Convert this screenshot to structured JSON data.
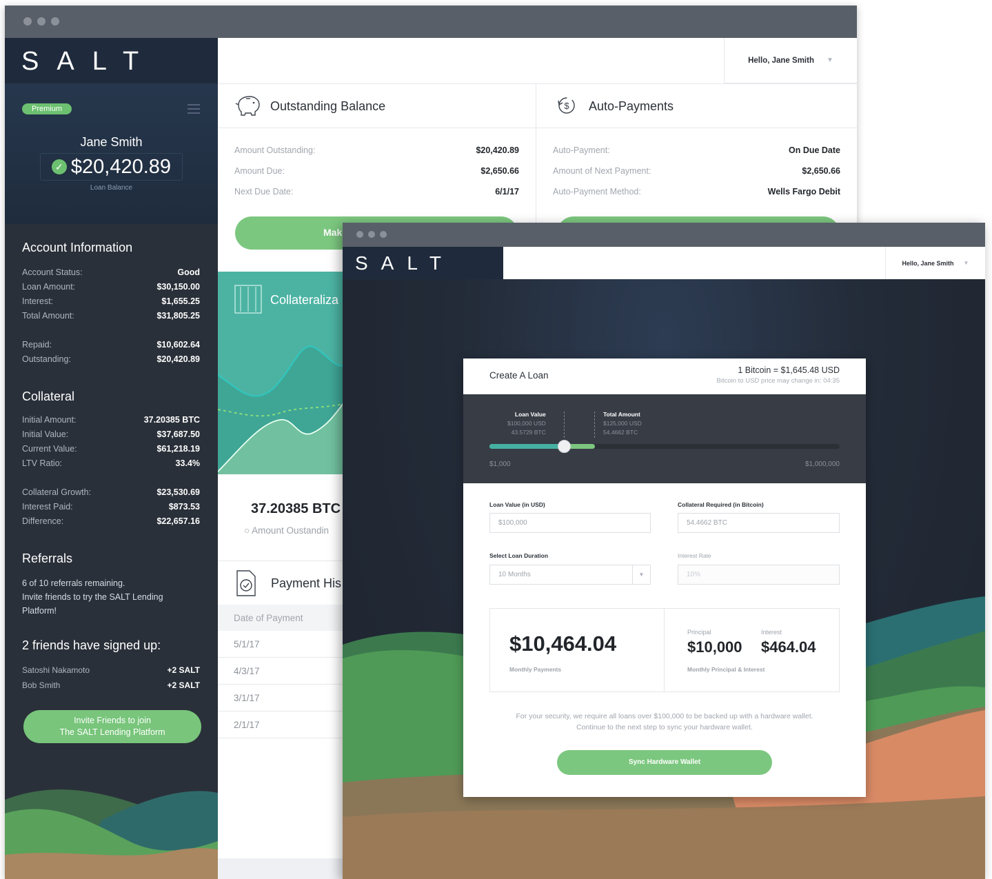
{
  "brand": {
    "logo": "SALT"
  },
  "colors": {
    "accent_green": "#7cc77f",
    "teal": "#4cb3a3",
    "sidebar_bg": "#2a3039",
    "navy": "#1f2b3c"
  },
  "sidebar": {
    "badge": "Premium",
    "user_name": "Jane Smith",
    "loan_balance": "$20,420.89",
    "loan_balance_label": "Loan Balance",
    "account_info": {
      "title": "Account Information",
      "rows": [
        {
          "k": "Account Status:",
          "v": "Good"
        },
        {
          "k": "Loan Amount:",
          "v": "$30,150.00"
        },
        {
          "k": "Interest:",
          "v": "$1,655.25"
        },
        {
          "k": "Total Amount:",
          "v": "$31,805.25"
        },
        {
          "k": "Repaid:",
          "v": "$10,602.64"
        },
        {
          "k": "Outstanding:",
          "v": "$20,420.89"
        }
      ]
    },
    "collateral": {
      "title": "Collateral",
      "rows": [
        {
          "k": "Initial Amount:",
          "v": "37.20385 BTC"
        },
        {
          "k": "Initial Value:",
          "v": "$37,687.50"
        },
        {
          "k": "Current Value:",
          "v": "$61,218.19"
        },
        {
          "k": "LTV Ratio:",
          "v": "33.4%"
        },
        {
          "k": "Collateral Growth:",
          "v": "$23,530.69"
        },
        {
          "k": "Interest Paid:",
          "v": "$873.53"
        },
        {
          "k": "Difference:",
          "v": "$22,657.16"
        }
      ]
    },
    "referrals": {
      "title": "Referrals",
      "remaining": "6 of 10 referrals remaining.",
      "invite_text": "Invite friends to try the SALT Lending Platform!",
      "signed_title": "2 friends have signed up:",
      "friends": [
        {
          "name": "Satoshi Nakamoto",
          "reward": "+2 SALT"
        },
        {
          "name": "Bob Smith",
          "reward": "+2 SALT"
        }
      ],
      "button_line1": "Invite Friends to join",
      "button_line2": "The SALT Lending Platform"
    }
  },
  "header": {
    "greeting": "Hello, Jane Smith"
  },
  "outstanding": {
    "title": "Outstanding Balance",
    "rows": [
      {
        "k": "Amount Outstanding:",
        "v": "$20,420.89"
      },
      {
        "k": "Amount Due:",
        "v": "$2,650.66"
      },
      {
        "k": "Next Due Date:",
        "v": "6/1/17"
      }
    ],
    "button": "Mak"
  },
  "autopay": {
    "title": "Auto-Payments",
    "rows": [
      {
        "k": "Auto-Payment:",
        "v": "On Due Date"
      },
      {
        "k": "Amount of Next Payment:",
        "v": "$2,650.66"
      },
      {
        "k": "Auto-Payment Method:",
        "v": "Wells Fargo Debit"
      }
    ]
  },
  "collateralization": {
    "title": "Collateraliza"
  },
  "btc_total": {
    "value": "37.20385 BTC",
    "legend": "Amount Oustandin"
  },
  "payment_history": {
    "title": "Payment His",
    "column": "Date of Payment",
    "rows": [
      "5/1/17",
      "4/3/17",
      "3/1/17",
      "2/1/17"
    ]
  },
  "front": {
    "greeting": "Hello, Jane Smith",
    "modal": {
      "title": "Create A Loan",
      "rate": "1 Bitcoin = $1,645.48 USD",
      "rate_note": "Bitcoin to USD price may change in: 04:35",
      "slider": {
        "loan_value_title": "Loan Value",
        "loan_value_usd": "$100,000 USD",
        "loan_value_btc": "43.5729 BTC",
        "total_title": "Total Amount",
        "total_usd": "$125,000 USD",
        "total_btc": "54.4662 BTC",
        "min": "$1,000",
        "max": "$1,000,000",
        "level": 0.2
      },
      "fields": {
        "loan_value_label": "Loan Value (in USD)",
        "loan_value": "$100,000",
        "collateral_label": "Collateral Required (in Bitcoin)",
        "collateral": "54.4662 BTC",
        "duration_label": "Select Loan Duration",
        "duration": "10 Months",
        "interest_label": "Interest Rate",
        "interest": "10%"
      },
      "summary": {
        "monthly": "$10,464.04",
        "monthly_label": "Monthly Payments",
        "principal_h": "Principal",
        "principal": "$10,000",
        "interest_h": "Interest",
        "interest": "$464.04",
        "pi_label": "Monthly Principal & Interest"
      },
      "note1": "For your security, we require all loans over $100,000 to be backed up with a hardware wallet.",
      "note2": "Continue to the next step to sync your hardware wallet.",
      "button": "Sync Hardware Wallet"
    }
  }
}
